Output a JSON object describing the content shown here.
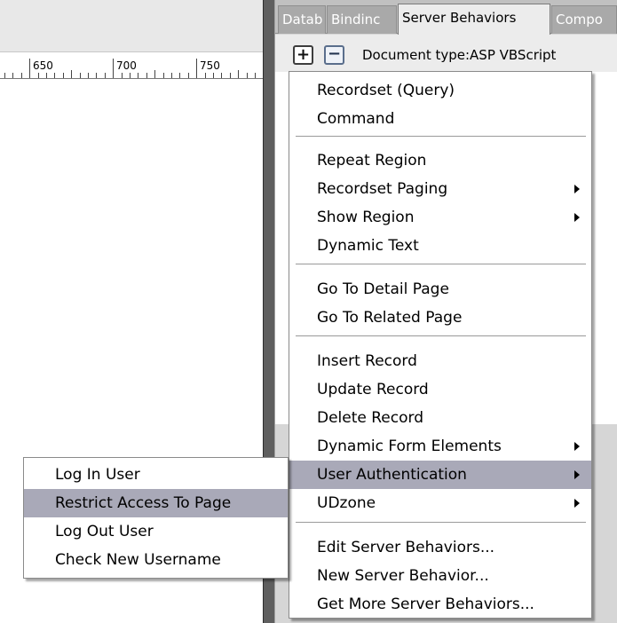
{
  "ruler": {
    "labels": [
      "650",
      "700",
      "750"
    ]
  },
  "panel": {
    "tabs": [
      {
        "label": "Datab"
      },
      {
        "label": "Bindinc"
      },
      {
        "label": "Server Behaviors"
      },
      {
        "label": "Compo"
      }
    ],
    "toolbar": {
      "add_icon": "plus-icon",
      "remove_icon": "minus-icon",
      "doctype": "Document type:ASP VBScript"
    }
  },
  "menu": {
    "items": [
      {
        "label": "Recordset (Query)"
      },
      {
        "label": "Command"
      },
      {
        "label": "Repeat Region"
      },
      {
        "label": "Recordset Paging"
      },
      {
        "label": "Show Region"
      },
      {
        "label": "Dynamic Text"
      },
      {
        "label": "Go To Detail Page"
      },
      {
        "label": "Go To Related Page"
      },
      {
        "label": "Insert Record"
      },
      {
        "label": "Update Record"
      },
      {
        "label": "Delete Record"
      },
      {
        "label": "Dynamic Form Elements"
      },
      {
        "label": "User Authentication"
      },
      {
        "label": "UDzone"
      },
      {
        "label": "Edit Server Behaviors..."
      },
      {
        "label": "New Server Behavior..."
      },
      {
        "label": "Get More Server Behaviors..."
      }
    ],
    "highlighted": "User Authentication"
  },
  "submenu": {
    "items": [
      {
        "label": "Log In User"
      },
      {
        "label": "Restrict Access To Page"
      },
      {
        "label": "Log Out User"
      },
      {
        "label": "Check New Username"
      }
    ],
    "highlighted": "Restrict Access To Page"
  },
  "colors": {
    "highlight": "#a9a9b8",
    "splitter": "#5f5f5f",
    "panel_bg": "#d6d6d6"
  }
}
